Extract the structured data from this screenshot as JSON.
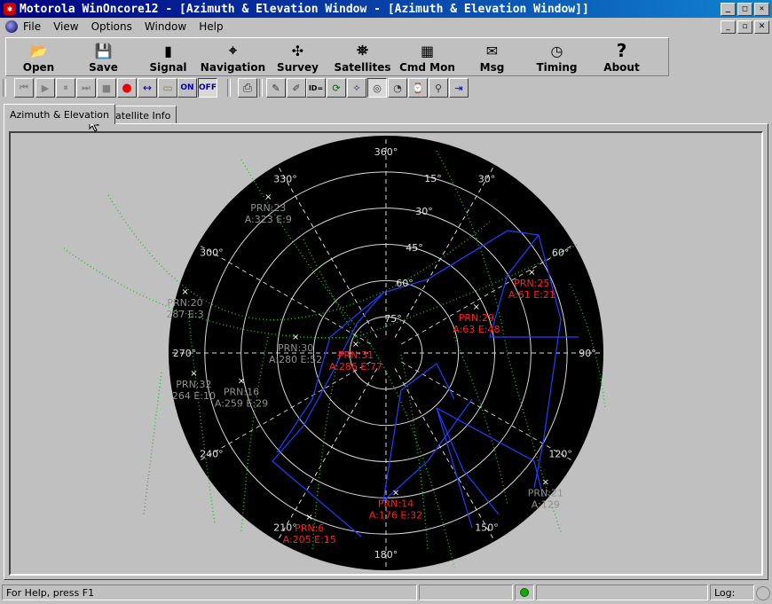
{
  "window": {
    "title": "Motorola WinOncore12 - [Azimuth & Elevation Window - [Azimuth & Elevation Window]]"
  },
  "menu": [
    "File",
    "View",
    "Options",
    "Window",
    "Help"
  ],
  "toolbar": [
    {
      "label": "Open",
      "icon": "folder-open-icon",
      "glyph": "📂"
    },
    {
      "label": "Save",
      "icon": "floppy-icon",
      "glyph": "💾"
    },
    {
      "label": "Signal",
      "icon": "signal-bars-icon",
      "glyph": "▮"
    },
    {
      "label": "Navigation",
      "icon": "compass-icon",
      "glyph": "⌖"
    },
    {
      "label": "Survey",
      "icon": "survey-icon",
      "glyph": "✣"
    },
    {
      "label": "Satellites",
      "icon": "satellite-icon",
      "glyph": "⛯"
    },
    {
      "label": "Cmd Mon",
      "icon": "cmd-monitor-icon",
      "glyph": "▦"
    },
    {
      "label": "Msg",
      "icon": "message-icon",
      "glyph": "✉"
    },
    {
      "label": "Timing",
      "icon": "clock-icon",
      "glyph": "◷"
    },
    {
      "label": "About",
      "icon": "help-icon",
      "glyph": "?"
    }
  ],
  "smalltoolbar": {
    "on_label": "ON",
    "off_label": "OFF",
    "id_label": "ID="
  },
  "tabs": [
    "Azimuth & Elevation",
    "Satellite Info"
  ],
  "sky": {
    "outer_labels": [
      {
        "text": "360°",
        "az": 0
      },
      {
        "text": "30°",
        "az": 30
      },
      {
        "text": "60°",
        "az": 60
      },
      {
        "text": "90°",
        "az": 90
      },
      {
        "text": "120°",
        "az": 120
      },
      {
        "text": "150°",
        "az": 150
      },
      {
        "text": "180°",
        "az": 180
      },
      {
        "text": "210°",
        "az": 210
      },
      {
        "text": "240°",
        "az": 240
      },
      {
        "text": "270°",
        "az": 270
      },
      {
        "text": "300°",
        "az": 300
      },
      {
        "text": "330°",
        "az": 330
      }
    ],
    "ring_labels": [
      "15°",
      "30°",
      "45°",
      "60°",
      "75°"
    ],
    "satellites": [
      {
        "prn": "PRN:23",
        "info": "A:323 E:9",
        "az": 323,
        "el": 9,
        "color": "gray"
      },
      {
        "prn": "PRN:20",
        "info": "287 E:3",
        "az": 287,
        "el": 3,
        "color": "gray"
      },
      {
        "prn": "PRN:25",
        "info": "A:61 E:21",
        "az": 61,
        "el": 21,
        "color": "red"
      },
      {
        "prn": "PRN:29",
        "info": "A:63 E:48",
        "az": 63,
        "el": 48,
        "color": "red"
      },
      {
        "prn": "PRN:31",
        "info": "A:286 E:77",
        "az": 286,
        "el": 77,
        "color": "red"
      },
      {
        "prn": "PRN:30",
        "info": "A:280 E:52",
        "az": 280,
        "el": 52,
        "color": "gray"
      },
      {
        "prn": "PRN:32",
        "info": "264 E:10",
        "az": 264,
        "el": 10,
        "color": "gray"
      },
      {
        "prn": "PRN:16",
        "info": "A:259 E:29",
        "az": 259,
        "el": 29,
        "color": "gray"
      },
      {
        "prn": "PRN:14",
        "info": "A:176 E:32",
        "az": 176,
        "el": 32,
        "color": "red"
      },
      {
        "prn": "PRN:6",
        "info": "A:205 E:15",
        "az": 205,
        "el": 15,
        "color": "red"
      },
      {
        "prn": "PRN:21",
        "info": "A:129",
        "az": 129,
        "el": 5,
        "color": "gray"
      }
    ]
  },
  "status": {
    "help": "For Help, press F1",
    "log": "Log:"
  },
  "colors": {
    "title_start": "#000080",
    "title_end": "#1084d0",
    "sky": "#000000",
    "ring": "#d8d8d8",
    "tracked": "#ff2020",
    "untracked": "#909090",
    "track_green": "#20c020",
    "track_blue": "#2040ff"
  }
}
